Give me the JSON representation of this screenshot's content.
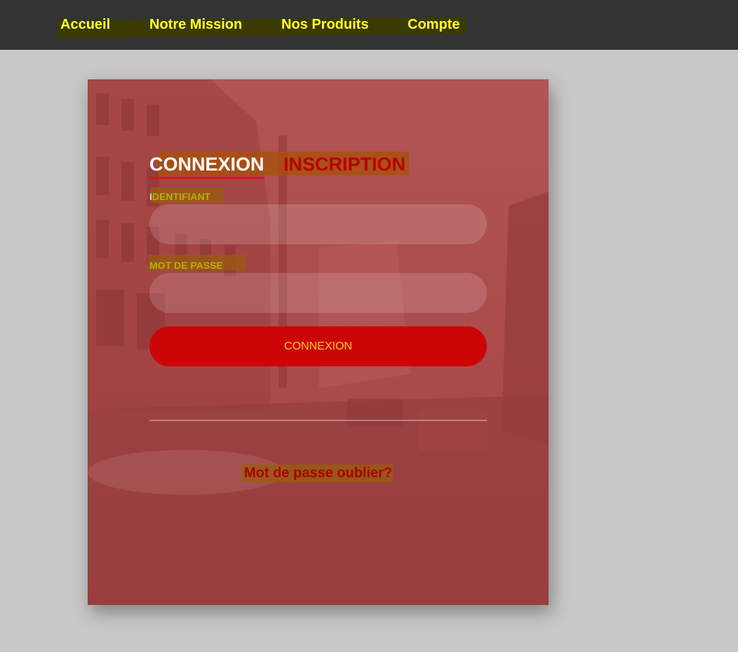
{
  "nav": {
    "items": [
      {
        "label": "Accueil"
      },
      {
        "label": "Notre Mission"
      },
      {
        "label": "Nos Produits"
      },
      {
        "label": "Compte"
      }
    ]
  },
  "login": {
    "tabs": [
      {
        "label": "CONNEXION",
        "active": true
      },
      {
        "label": "INSCRIPTION",
        "active": false
      }
    ],
    "identifiant": {
      "label_first": "I",
      "label_rest": "DENTIFIANT",
      "value": "",
      "placeholder": ""
    },
    "password": {
      "label": "MOT DE PASSE",
      "value": "",
      "placeholder": ""
    },
    "submit_label": "CONNEXION",
    "forgot_label": "Mot de passe oublier?"
  },
  "colors": {
    "topbar": "#333333",
    "nav_text": "#ffff33",
    "card_overlay": "#a94848",
    "button": "#cc0606",
    "button_text": "#ffcc22",
    "active_tab": "#ffffff",
    "inactive_tab": "#bb0000"
  },
  "icons": {
    "background": "city-street-photo"
  }
}
